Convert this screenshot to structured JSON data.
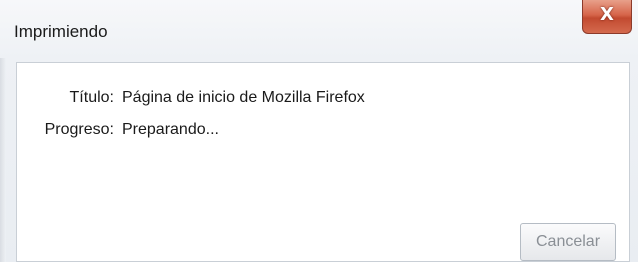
{
  "window": {
    "title": "Imprimiendo",
    "close_label": "X"
  },
  "dialog": {
    "title_label": "Título:",
    "title_value": "Página de inicio de Mozilla Firefox",
    "progress_label": "Progreso:",
    "progress_value": "Preparando...",
    "cancel_label": "Cancelar"
  },
  "colors": {
    "close_button": "#d6654a",
    "frame": "#eef1f5",
    "content_bg": "#ffffff",
    "disabled_text": "#8a8f95"
  }
}
